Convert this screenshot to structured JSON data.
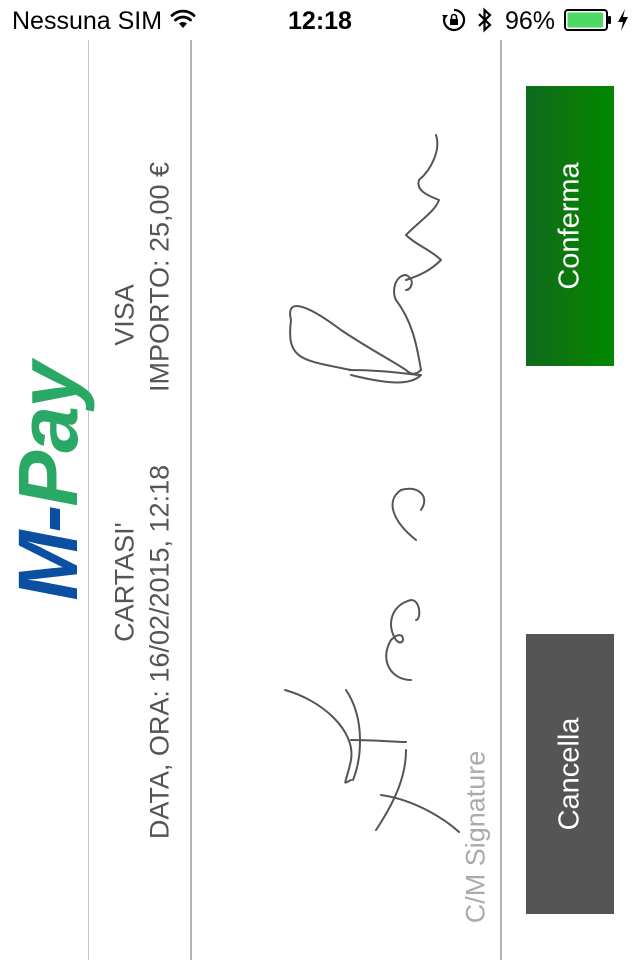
{
  "status_bar": {
    "carrier": "Nessuna SIM",
    "time": "12:18",
    "battery_percent": "96%",
    "battery_level": 0.96,
    "icons": [
      "wifi-icon",
      "rotation-lock-icon",
      "bluetooth-icon",
      "battery-icon",
      "charging-bolt-icon"
    ],
    "battery_color": "#4cd964"
  },
  "logo": {
    "part1": "M-",
    "part2": "Pay",
    "color1": "#0b4fa2",
    "color2": "#2aa865"
  },
  "transaction": {
    "card_circuit": "CARTASI'",
    "card_brand": "VISA",
    "datetime": "DATA, ORA: 16/02/2015, 12:18",
    "amount": "IMPORTO: 25,00 €"
  },
  "signature": {
    "caption": "C/M Signature"
  },
  "buttons": {
    "confirm_label": "Conferma",
    "cancel_label": "Cancella",
    "confirm_color": "#0a7a0a",
    "cancel_color": "#555555"
  }
}
